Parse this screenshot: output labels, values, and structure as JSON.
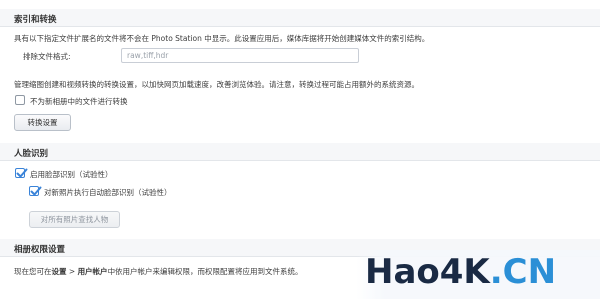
{
  "indexing": {
    "title": "索引和转换",
    "description": "具有以下指定文件扩展名的文件将不会在 Photo Station 中显示。此设置应用后，媒体库据将开始创建媒体文件的索引结构。",
    "exclude_label": "排除文件格式:",
    "exclude_placeholder": "raw,tiff,hdr",
    "conversion_description": "管理缩图创建和视频转换的转换设置，以加快网页加载速度，改善浏览体验。请注意，转换过程可能占用额外的系统资源。",
    "skip_new_albums_label": "不为新相册中的文件进行转换",
    "skip_new_albums_checked": false,
    "convert_button_label": "转换设置"
  },
  "face_recognition": {
    "title": "人脸识别",
    "enable_label": "启用脸部识别（试验性）",
    "enable_checked": true,
    "auto_new_photos_label": "对新照片执行自动脸部识别（试验性）",
    "auto_new_photos_checked": true,
    "find_people_button_label": "对所有照片查找人物"
  },
  "album_permissions": {
    "title": "相册权限设置",
    "text_prefix": "现在您可在",
    "path_settings": "设置",
    "path_separator": " > ",
    "path_user_accounts": "用户帐户",
    "text_suffix": "中依用户帐户来编辑权限，而权限配置将应用到文件系统。"
  },
  "watermark": {
    "main": "Hao4K",
    "suffix": ".CN"
  },
  "colors": {
    "accent": "#3a83d8",
    "header_bg": "#f6f7f9",
    "border": "#e3e6ea"
  }
}
